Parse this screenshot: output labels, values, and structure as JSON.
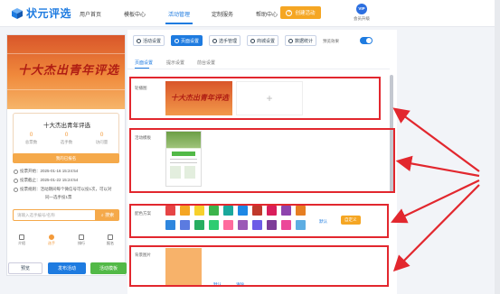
{
  "brand": {
    "name": "状元评选",
    "color": "#1e7be0"
  },
  "nav": {
    "items": [
      "用户首页",
      "模板中心",
      "活动管理",
      "定制服务",
      "帮助中心"
    ],
    "active": "活动管理"
  },
  "header": {
    "create_label": "创建活动",
    "vip_badge": "VIP",
    "vip_label": "会员升级"
  },
  "preview": {
    "banner_text": "十大杰出青年评选",
    "title": "十大杰出青年评选",
    "stats": [
      {
        "value": "0",
        "label": "总票数"
      },
      {
        "value": "0",
        "label": "选手数"
      },
      {
        "value": "0",
        "label": "访问量"
      }
    ],
    "vote_button": "我的已报名",
    "start_time": "投票开始：2025-01-16 15:24:54",
    "end_time": "投票截止：2025-01-22 15:24:54",
    "rule": "投票规则：活动期间每个微信号可以投1次，可以对",
    "rule_cont": "同一选手投1票",
    "search_placeholder": "请输入选手编号/名称",
    "search_button": "搜索",
    "tabs": [
      "介绍",
      "选手",
      "排行",
      "报名"
    ],
    "active_tab": "选手",
    "buttons": {
      "preview": "预览",
      "publish": "发布活动",
      "template": "活动模板"
    }
  },
  "toolbar": {
    "tabs": [
      "活动设置",
      "页面设置",
      "选手管理",
      "商城设置",
      "数据统计"
    ],
    "active": "页面设置",
    "preview_label": "预览效果",
    "preview_toggle": true
  },
  "subtabs": {
    "items": [
      "页面设置",
      "提示设置",
      "前台设置"
    ],
    "active": "页面设置"
  },
  "sections": {
    "banner": {
      "label": "轮播图",
      "banner_text": "十大杰出青年评选"
    },
    "template": {
      "label": "活动模板"
    },
    "color": {
      "label": "配色方案",
      "default_label": "默认",
      "custom_label": "自定义",
      "colors": [
        "#e64545",
        "#f5a623",
        "#f7d02c",
        "#3cb44b",
        "#1aa89c",
        "#1e88e5",
        "#c0392b",
        "#d91e5b",
        "#8e44ad",
        "#e67e22",
        "#2e86de",
        "#5b7be0",
        "#27ae60",
        "#2ecc71",
        "#ff6b9d",
        "#9b59b6",
        "#6c5ce7",
        "#7d3c98",
        "#ec4899",
        "#5dade2"
      ]
    },
    "background": {
      "label": "背景图片",
      "default_label": "默认",
      "clear_label": "清除"
    }
  }
}
